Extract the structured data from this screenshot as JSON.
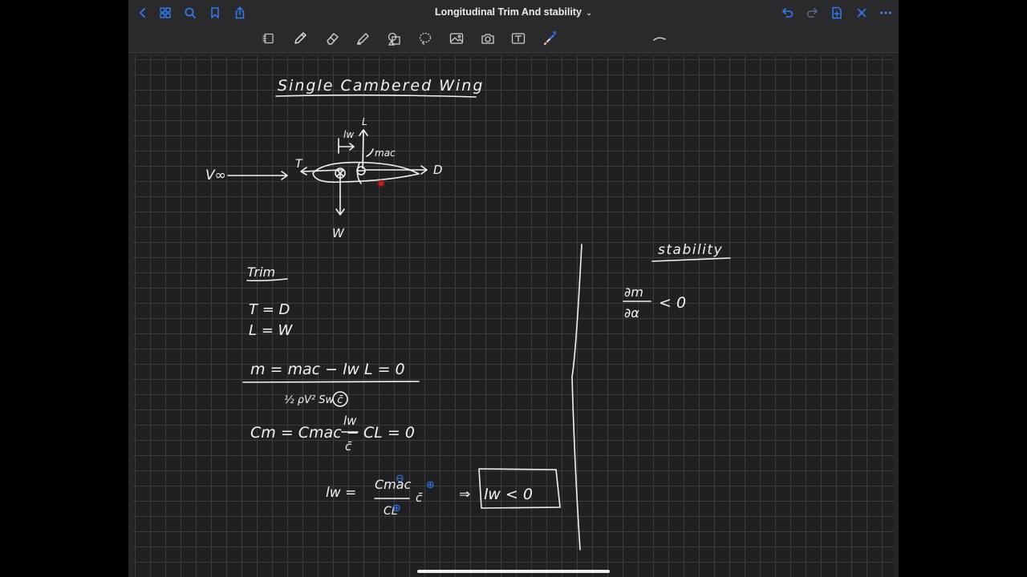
{
  "document": {
    "title": "Longitudinal Trim And stability",
    "title_chevron": "⌄"
  },
  "colors": {
    "ink": "#f2f2f2",
    "blue_ink": "#2f7df6",
    "accent": "#2f7df6",
    "laser": "#d01818"
  },
  "topbar": {
    "left_icons": [
      "chevron-left-icon",
      "grid-icon",
      "search-icon",
      "bookmark-icon",
      "share-icon"
    ],
    "right_icons": [
      "undo-icon",
      "redo-icon",
      "add-page-icon",
      "close-icon",
      "more-icon"
    ]
  },
  "toolbar": {
    "tools": [
      "reader-icon",
      "pen-icon",
      "eraser-icon",
      "highlighter-icon",
      "shapes-icon",
      "lasso-icon",
      "image-icon",
      "camera-icon",
      "text-icon",
      "laser-pointer-icon"
    ],
    "pen_tip_icon": "dot-icon",
    "stroke_icon": "stroke-curve-icon"
  },
  "notes": {
    "heading_wing": "Single Cambered Wing",
    "label_L": "L",
    "label_lw_top": "lw",
    "label_mac": "mac",
    "label_Vinf": "V∞",
    "label_T": "T",
    "label_D": "D",
    "label_W": "W",
    "heading_trim": "Trim",
    "eq_T": "T = D",
    "eq_L": "L = W",
    "eq_m": "m  =  mac  − lw L  = 0",
    "eq_denominator": "½ ρV² Sw c̄",
    "eq_Cm": "Cm  =  Cmac  −",
    "eq_Cm_frac_num": "lw",
    "eq_Cm_frac_den": "c̄",
    "eq_Cm_tail": "CL  = 0",
    "eq_lw_lhs": "lw =",
    "eq_lw_num": "Cmac",
    "eq_lw_den": "CL",
    "eq_lw_cbar": "c̄",
    "eq_lw_arrow": "⇒",
    "boxed_result": "lw < 0",
    "minus_sign": "⊖",
    "plus_sign": "⊕",
    "heading_stability": "stability",
    "stab_num": "∂m",
    "stab_den": "∂α",
    "stab_rel": "< 0"
  }
}
